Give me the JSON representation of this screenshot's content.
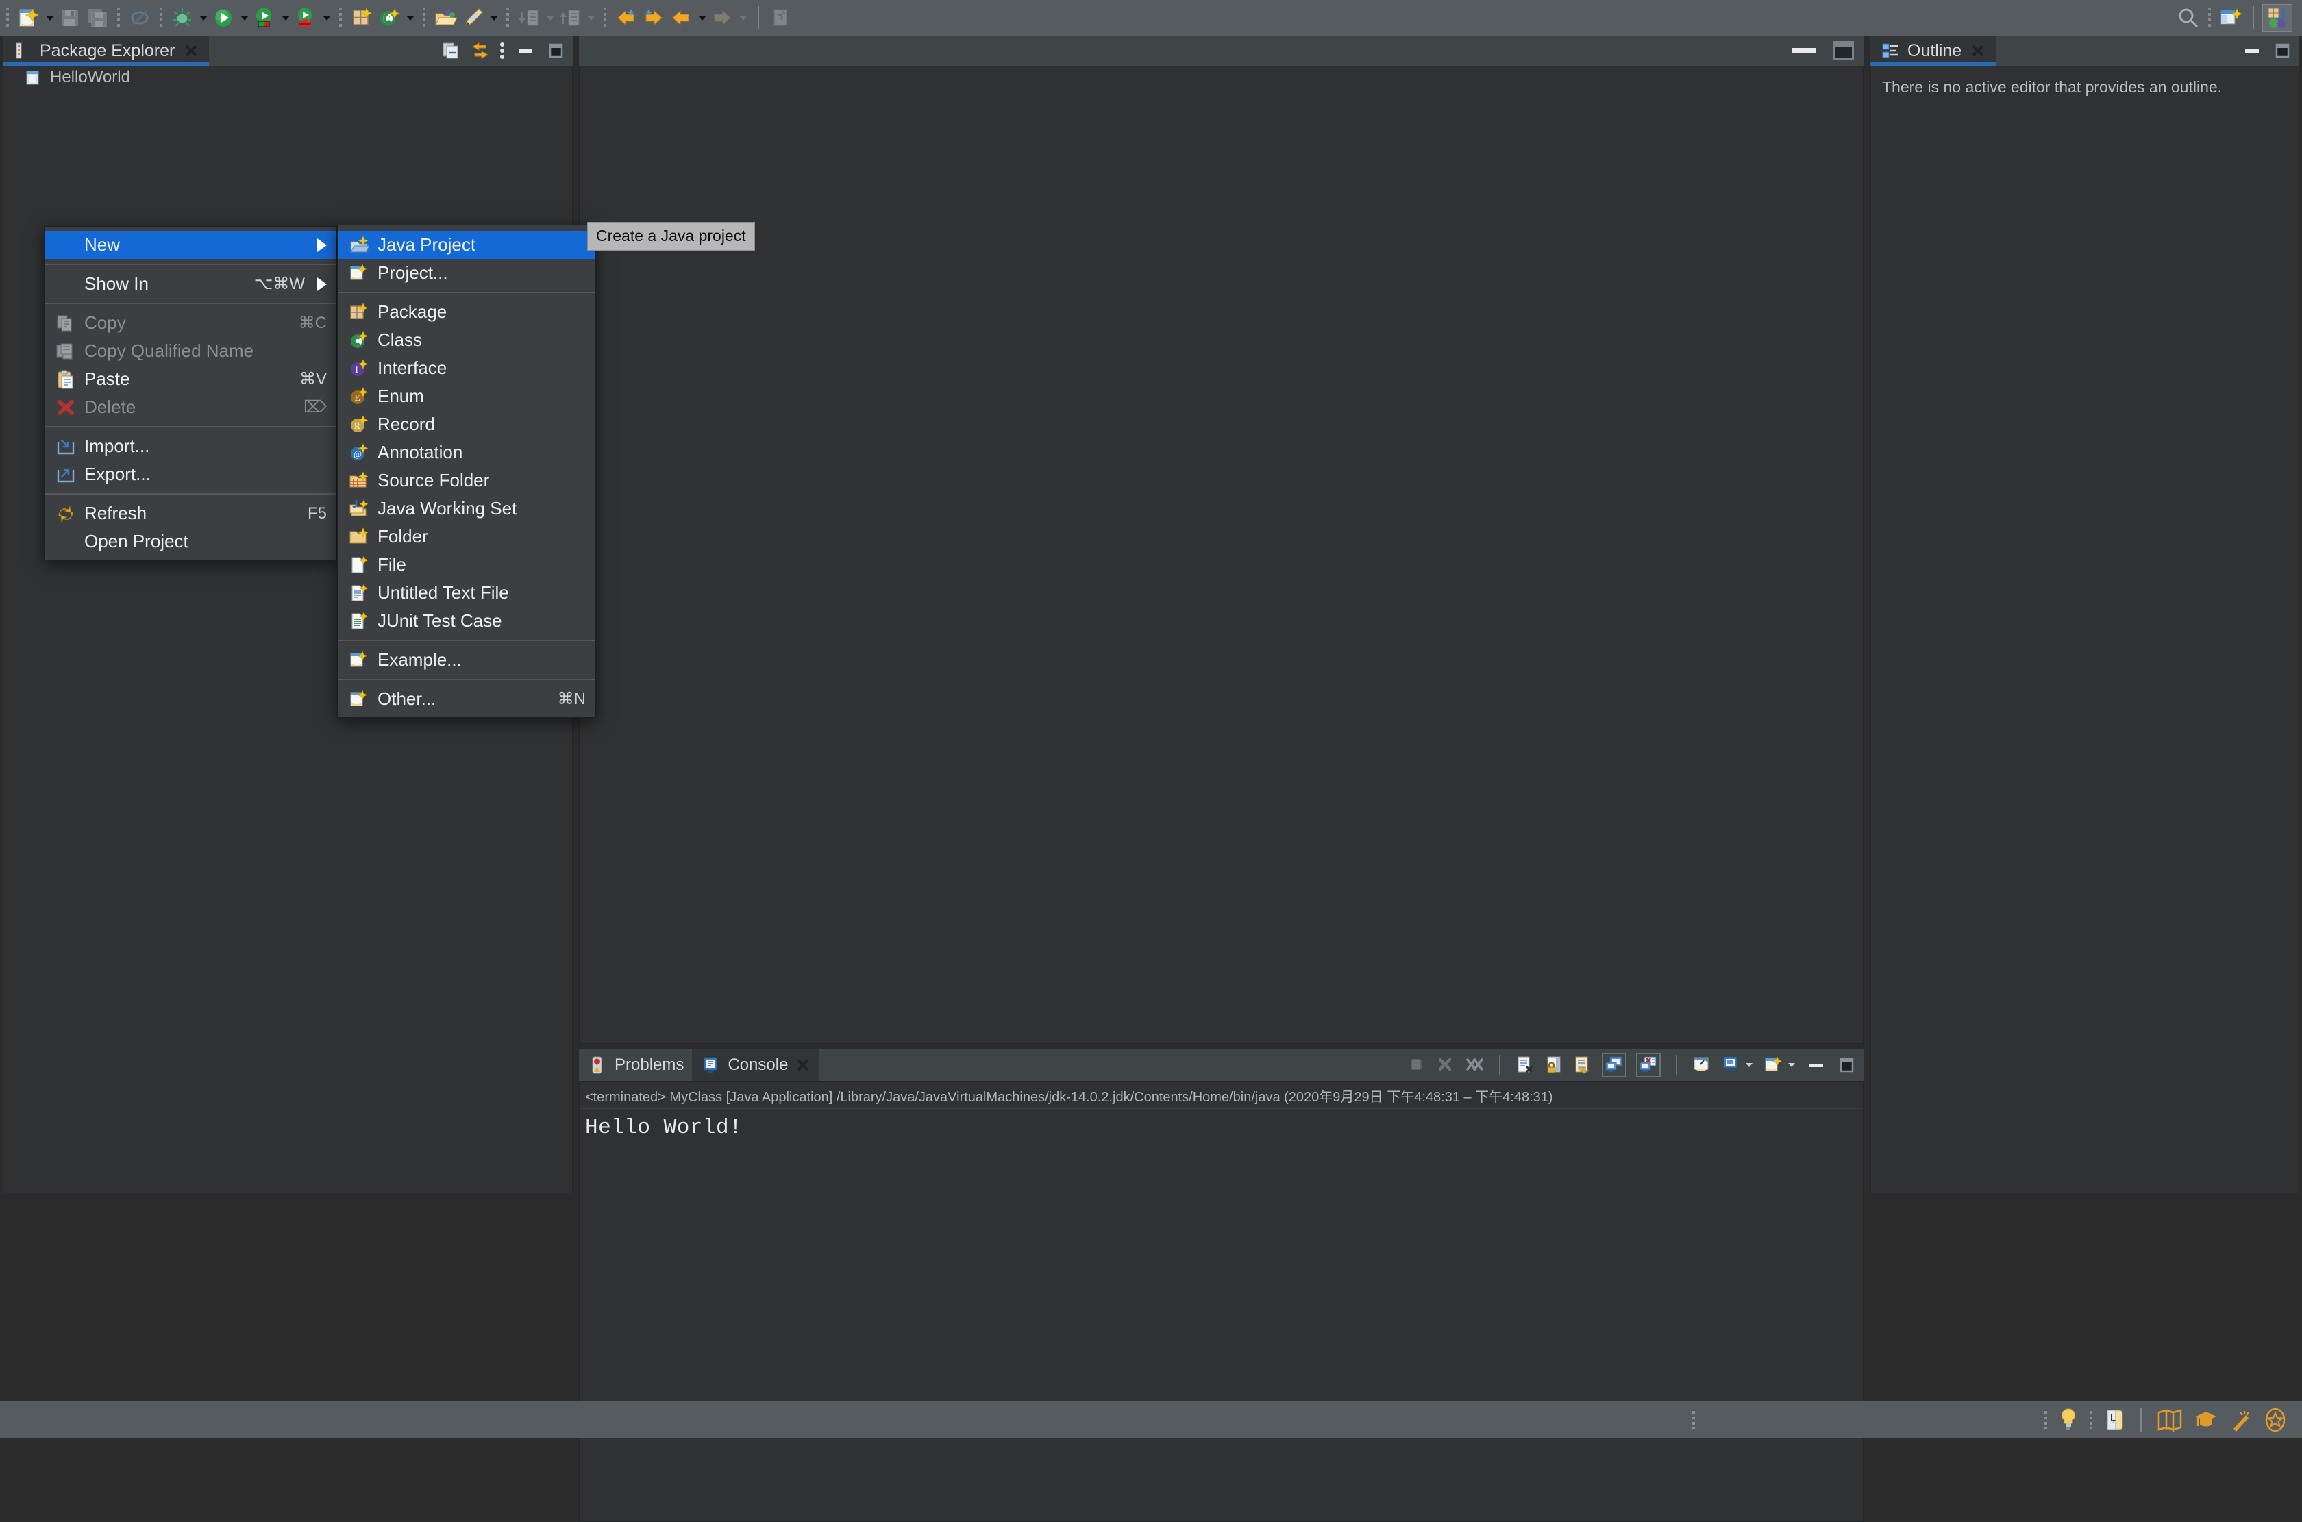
{
  "toolbar": {
    "buttons": [
      {
        "name": "new-wizard",
        "icon": "new-file-icon",
        "dropdown": true,
        "enabled": true
      },
      {
        "name": "save",
        "icon": "save-icon",
        "dropdown": false,
        "enabled": false
      },
      {
        "name": "save-all",
        "icon": "save-all-icon",
        "dropdown": false,
        "enabled": false
      },
      {
        "name": "print",
        "icon": "print-disabled-icon",
        "dropdown": false,
        "enabled": false
      },
      {
        "name": "debug",
        "icon": "debug-bug-icon",
        "dropdown": true,
        "enabled": true
      },
      {
        "name": "run",
        "icon": "run-green-play-icon",
        "dropdown": true,
        "enabled": true
      },
      {
        "name": "coverage",
        "icon": "run-coverage-icon",
        "dropdown": true,
        "enabled": true
      },
      {
        "name": "external-tools",
        "icon": "external-tools-icon",
        "dropdown": true,
        "enabled": true
      },
      {
        "name": "new-package",
        "icon": "new-package-icon",
        "dropdown": false,
        "enabled": true
      },
      {
        "name": "new-class",
        "icon": "new-class-icon",
        "dropdown": true,
        "enabled": true
      },
      {
        "name": "open-type",
        "icon": "open-type-folder-icon",
        "dropdown": false,
        "enabled": true
      },
      {
        "name": "pencil",
        "icon": "pencil-icon",
        "dropdown": true,
        "enabled": true
      },
      {
        "name": "previous-annotation",
        "icon": "prev-annotation-icon",
        "dropdown": true,
        "enabled": false
      },
      {
        "name": "next-annotation",
        "icon": "next-annotation-icon",
        "dropdown": true,
        "enabled": false
      },
      {
        "name": "back",
        "icon": "back-arrow-icon",
        "dropdown": true,
        "enabled": true
      },
      {
        "name": "forward",
        "icon": "forward-arrow-icon",
        "dropdown": true,
        "enabled": true
      },
      {
        "name": "last-edit",
        "icon": "last-edit-location-icon",
        "dropdown": true,
        "enabled": false
      },
      {
        "name": "next-edit",
        "icon": "next-edit-icon",
        "dropdown": true,
        "enabled": false
      },
      {
        "name": "pin-editor",
        "icon": "pin-editor-icon",
        "dropdown": false,
        "enabled": false
      }
    ],
    "right": {
      "search_icon": "search-icon",
      "overflow_icon": "toolbar-overflow-icon",
      "open-perspective_icon": "open-perspective-icon",
      "active_perspective_icon": "java-perspective-icon"
    }
  },
  "package_explorer": {
    "title": "Package Explorer",
    "close_icon": "close-icon",
    "view_icon": "package-explorer-icon",
    "toolbar_icons": [
      "collapse-all-icon",
      "link-with-editor-icon",
      "view-menu-icon",
      "minimize-icon",
      "maximize-icon"
    ],
    "tree": [
      {
        "label": "HelloWorld",
        "icon": "java-project-icon"
      }
    ]
  },
  "editor_area": {
    "minimize_icon": "minimize-icon",
    "maximize_icon": "maximize-icon"
  },
  "outline": {
    "title": "Outline",
    "view_icon": "outline-icon",
    "close_icon": "close-icon",
    "message": "There is no active editor that provides an outline.",
    "toolbar_icons": [
      "minimize-icon",
      "maximize-icon"
    ]
  },
  "bottom_panel": {
    "tabs": [
      {
        "label": "Problems",
        "icon": "problems-icon",
        "active": false,
        "closable": false
      },
      {
        "label": "Console",
        "icon": "console-icon",
        "active": true,
        "closable": true
      }
    ],
    "toolbar_icons": [
      "terminate-icon",
      "remove-launch-icon",
      "remove-all-launches-icon",
      "clear-console-icon",
      "lock-scroll-icon",
      "word-wrap-icon",
      "show-console-on-output-icon",
      "show-console-on-error-icon",
      "pin-console-icon",
      "display-selected-console-icon",
      "open-console-icon",
      "minimize-icon",
      "maximize-icon"
    ],
    "console": {
      "header": "<terminated> MyClass [Java Application] /Library/Java/JavaVirtualMachines/jdk-14.0.2.jdk/Contents/Home/bin/java  (2020年9月29日 下午4:48:31 – 下午4:48:31)",
      "output": "Hello World!"
    }
  },
  "context_menu": {
    "items": [
      {
        "label": "New",
        "accel": "",
        "icon": "",
        "submenu": true,
        "selected": true,
        "disabled": false
      },
      {
        "separator": true
      },
      {
        "label": "Show In",
        "accel": "⌥⌘W",
        "icon": "",
        "submenu": true,
        "selected": false,
        "disabled": false
      },
      {
        "separator": true
      },
      {
        "label": "Copy",
        "accel": "⌘C",
        "icon": "copy-icon",
        "submenu": false,
        "selected": false,
        "disabled": true
      },
      {
        "label": "Copy Qualified Name",
        "accel": "",
        "icon": "copy-qualified-name-icon",
        "submenu": false,
        "selected": false,
        "disabled": true
      },
      {
        "label": "Paste",
        "accel": "⌘V",
        "icon": "paste-icon",
        "submenu": false,
        "selected": false,
        "disabled": false
      },
      {
        "label": "Delete",
        "accel": "⌦",
        "icon": "delete-x-icon",
        "submenu": false,
        "selected": false,
        "disabled": true
      },
      {
        "separator": true
      },
      {
        "label": "Import...",
        "accel": "",
        "icon": "import-icon",
        "submenu": false,
        "selected": false,
        "disabled": false
      },
      {
        "label": "Export...",
        "accel": "",
        "icon": "export-icon",
        "submenu": false,
        "selected": false,
        "disabled": false
      },
      {
        "separator": true
      },
      {
        "label": "Refresh",
        "accel": "F5",
        "icon": "refresh-icon",
        "submenu": false,
        "selected": false,
        "disabled": false
      },
      {
        "label": "Open Project",
        "accel": "",
        "icon": "",
        "submenu": false,
        "selected": false,
        "disabled": false
      }
    ]
  },
  "new_submenu": {
    "items": [
      {
        "label": "Java Project",
        "accel": "",
        "icon": "new-java-project-icon",
        "selected": true
      },
      {
        "label": "Project...",
        "accel": "",
        "icon": "new-project-icon",
        "selected": false
      },
      {
        "separator": true
      },
      {
        "label": "Package",
        "accel": "",
        "icon": "new-package-icon",
        "selected": false
      },
      {
        "label": "Class",
        "accel": "",
        "icon": "new-class-icon",
        "selected": false
      },
      {
        "label": "Interface",
        "accel": "",
        "icon": "new-interface-icon",
        "selected": false
      },
      {
        "label": "Enum",
        "accel": "",
        "icon": "new-enum-icon",
        "selected": false
      },
      {
        "label": "Record",
        "accel": "",
        "icon": "new-record-icon",
        "selected": false
      },
      {
        "label": "Annotation",
        "accel": "",
        "icon": "new-annotation-icon",
        "selected": false
      },
      {
        "label": "Source Folder",
        "accel": "",
        "icon": "new-source-folder-icon",
        "selected": false
      },
      {
        "label": "Java Working Set",
        "accel": "",
        "icon": "new-java-working-set-icon",
        "selected": false
      },
      {
        "label": "Folder",
        "accel": "",
        "icon": "new-folder-icon",
        "selected": false
      },
      {
        "label": "File",
        "accel": "",
        "icon": "new-file-icon",
        "selected": false
      },
      {
        "label": "Untitled Text File",
        "accel": "",
        "icon": "new-text-file-icon",
        "selected": false
      },
      {
        "label": "JUnit Test Case",
        "accel": "",
        "icon": "new-junit-test-icon",
        "selected": false
      },
      {
        "separator": true
      },
      {
        "label": "Example...",
        "accel": "",
        "icon": "new-example-icon",
        "selected": false
      },
      {
        "separator": true
      },
      {
        "label": "Other...",
        "accel": "⌘N",
        "icon": "new-other-icon",
        "selected": false
      }
    ]
  },
  "tooltip": {
    "text": "Create a Java project"
  },
  "status_bar": {
    "right_icons": [
      "tip-of-the-day-icon",
      "keyboard-shortcut-icon",
      "map-icon",
      "graduation-cap-icon",
      "magic-wand-icon",
      "star-badge-icon"
    ]
  },
  "colors": {
    "toolbar_bg": "#555b5e",
    "panel_bg": "#2f3133",
    "tabbar_bg": "#3f4447",
    "menu_bg": "#3c3f41",
    "selection_blue": "#1569d6",
    "tab_underline": "#2a6ab5",
    "text": "#eceff1",
    "text_dim": "#8b8f93",
    "tooltip_bg": "#b7b7b7"
  }
}
